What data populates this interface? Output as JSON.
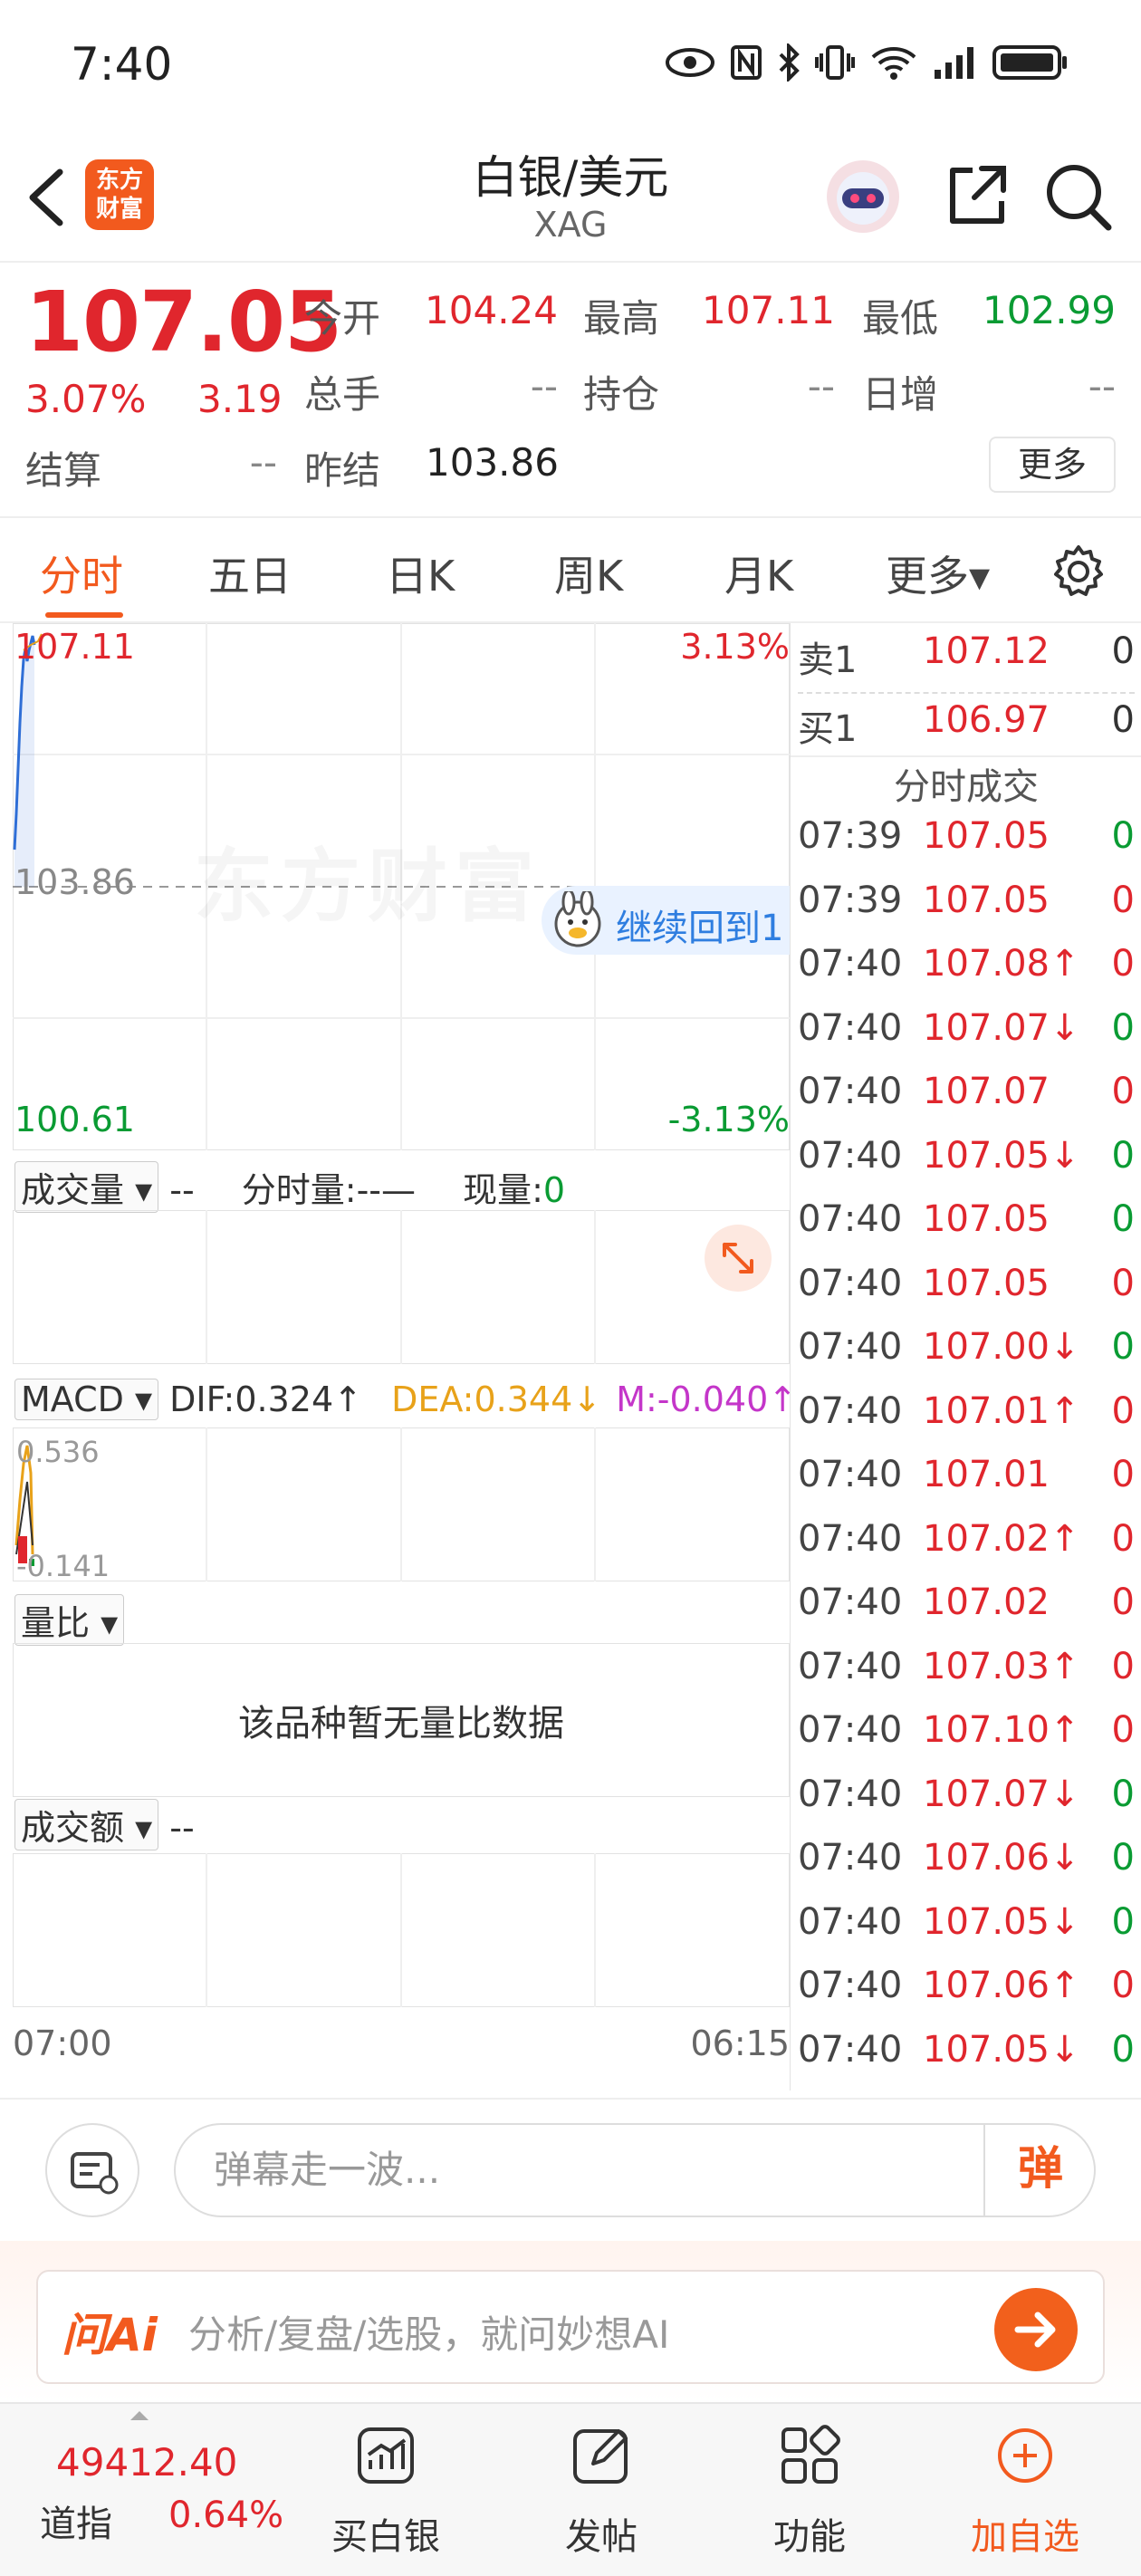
{
  "status_bar": {
    "time": "7:40"
  },
  "header": {
    "logo_text": "东方\n财富",
    "title": "白银/美元",
    "subtitle": "XAG"
  },
  "quote": {
    "price": "107.05",
    "change_pct": "3.07%",
    "change": "3.19",
    "fields": [
      {
        "label": "今开",
        "value": "104.24",
        "color": "red"
      },
      {
        "label": "最高",
        "value": "107.11",
        "color": "red"
      },
      {
        "label": "最低",
        "value": "102.99",
        "color": "green"
      },
      {
        "label": "总手",
        "value": "--",
        "color": "gray"
      },
      {
        "label": "持仓",
        "value": "--",
        "color": "gray"
      },
      {
        "label": "日增",
        "value": "--",
        "color": "gray"
      },
      {
        "label": "结算",
        "value": "--",
        "color": "gray"
      },
      {
        "label": "昨结",
        "value": "103.86",
        "color": "dark"
      }
    ],
    "more_label": "更多"
  },
  "tabs": [
    "分时",
    "五日",
    "日K",
    "周K",
    "月K",
    "更多▾"
  ],
  "chart": {
    "high": "107.11",
    "high_pct": "3.13%",
    "mid": "103.86",
    "low": "100.61",
    "low_pct": "-3.13%",
    "watermark": "东方财富",
    "tooltip": "继续回到1",
    "volume": {
      "selector": "成交量 ▾",
      "dash": "--",
      "time_vol": "分时量:--—",
      "cur_vol_label": "现量:",
      "cur_vol": "0"
    },
    "macd": {
      "selector": "MACD ▾",
      "dif": "DIF:0.324↑",
      "dea": "DEA:0.344↓",
      "m": "M:-0.040↑",
      "top": "0.536",
      "bottom": "-0.141"
    },
    "ratio": {
      "selector": "量比 ▾",
      "empty": "该品种暂无量比数据"
    },
    "amount": {
      "selector": "成交额 ▾",
      "dash": "--"
    },
    "x_start": "07:00",
    "x_end": "06:15"
  },
  "orderbook": {
    "sell1": {
      "label": "卖1",
      "price": "107.12",
      "vol": "0"
    },
    "buy1": {
      "label": "买1",
      "price": "106.97",
      "vol": "0"
    },
    "trades_title": "分时成交"
  },
  "trades": [
    {
      "time": "07:39",
      "price": "107.05",
      "vol": "0",
      "vc": "green"
    },
    {
      "time": "07:39",
      "price": "107.05",
      "vol": "0",
      "vc": "red"
    },
    {
      "time": "07:40",
      "price": "107.08↑",
      "vol": "0",
      "vc": "red"
    },
    {
      "time": "07:40",
      "price": "107.07↓",
      "vol": "0",
      "vc": "green"
    },
    {
      "time": "07:40",
      "price": "107.07",
      "vol": "0",
      "vc": "red"
    },
    {
      "time": "07:40",
      "price": "107.05↓",
      "vol": "0",
      "vc": "green"
    },
    {
      "time": "07:40",
      "price": "107.05",
      "vol": "0",
      "vc": "green"
    },
    {
      "time": "07:40",
      "price": "107.05",
      "vol": "0",
      "vc": "red"
    },
    {
      "time": "07:40",
      "price": "107.00↓",
      "vol": "0",
      "vc": "green"
    },
    {
      "time": "07:40",
      "price": "107.01↑",
      "vol": "0",
      "vc": "red"
    },
    {
      "time": "07:40",
      "price": "107.01",
      "vol": "0",
      "vc": "red"
    },
    {
      "time": "07:40",
      "price": "107.02↑",
      "vol": "0",
      "vc": "red"
    },
    {
      "time": "07:40",
      "price": "107.02",
      "vol": "0",
      "vc": "red"
    },
    {
      "time": "07:40",
      "price": "107.03↑",
      "vol": "0",
      "vc": "red"
    },
    {
      "time": "07:40",
      "price": "107.10↑",
      "vol": "0",
      "vc": "red"
    },
    {
      "time": "07:40",
      "price": "107.07↓",
      "vol": "0",
      "vc": "green"
    },
    {
      "time": "07:40",
      "price": "107.06↓",
      "vol": "0",
      "vc": "green"
    },
    {
      "time": "07:40",
      "price": "107.05↓",
      "vol": "0",
      "vc": "green"
    },
    {
      "time": "07:40",
      "price": "107.06↑",
      "vol": "0",
      "vc": "red"
    },
    {
      "time": "07:40",
      "price": "107.05↓",
      "vol": "0",
      "vc": "green"
    }
  ],
  "danmu": {
    "placeholder": "弹幕走一波...",
    "button": "弹"
  },
  "ai": {
    "logo": "问Ai",
    "placeholder": "分析/复盘/选股，就问妙想AI"
  },
  "bottom_nav": {
    "index_value": "49412.40",
    "index_name": "道指",
    "index_pct": "0.64%",
    "items": [
      {
        "label": "买白银",
        "icon": "chart-icon"
      },
      {
        "label": "发帖",
        "icon": "edit-icon"
      },
      {
        "label": "功能",
        "icon": "grid-icon"
      },
      {
        "label": "加自选",
        "icon": "plus-circle-icon"
      }
    ]
  },
  "colors": {
    "accent": "#f25a1e",
    "up": "#e0262d",
    "down": "#0a9b33",
    "line": "#2f6fd6",
    "dea": "#e8a21a",
    "m": "#c436c9"
  }
}
